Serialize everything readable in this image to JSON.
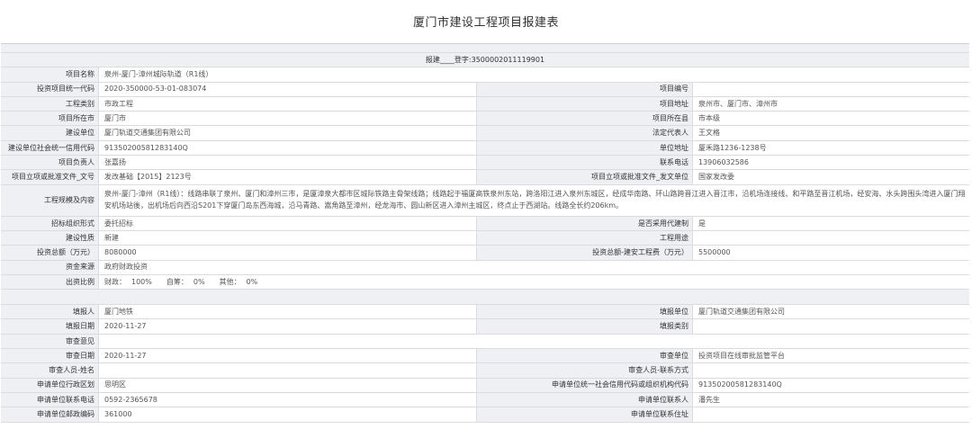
{
  "page_title": "厦门市建设工程项目报建表",
  "header": {
    "reg_label": "报建____登字:",
    "reg_number": "3500002011119901"
  },
  "rows": {
    "project_name": {
      "label": "项目名称",
      "value": "泉州-厦门-漳州城际轨道（R1线）"
    },
    "code": {
      "label": "投资项目统一代码",
      "value": "2020-350000-53-01-083074",
      "label2": "项目编号",
      "value2": ""
    },
    "category": {
      "label": "工程类别",
      "value": "市政工程",
      "label2": "项目地址",
      "value2": "泉州市、厦门市、漳州市"
    },
    "location": {
      "label": "项目所在市",
      "value": "厦门市",
      "label2": "项目所在县",
      "value2": "市本级"
    },
    "builder": {
      "label": "建设单位",
      "value": "厦门轨道交通集团有限公司",
      "label2": "法定代表人",
      "value2": "王文格"
    },
    "credit": {
      "label": "建设单位社会统一信用代码",
      "value": "91350200581283140Q",
      "label2": "单位地址",
      "value2": "厦禾路1236-1238号"
    },
    "leader": {
      "label": "项目负责人",
      "value": "张嘉扬",
      "label2": "联系电话",
      "value2": "13906032586"
    },
    "approval": {
      "label": "项目立项或批准文件_文号",
      "value": "发改基础【2015】2123号",
      "label2": "项目立项或批准文件_发文单位",
      "value2": "国家发改委"
    },
    "scale": {
      "label": "工程规模及内容",
      "value": "泉州-厦门-漳州（R1线）：线路串联了泉州、厦门和漳州三市，是厦漳泉大都市区城际铁路主骨架线路；线路起于福厦高铁泉州东站，跨洛阳江进入泉州东城区，经成华南路、环山路跨晋江进入晋江市，沿机场连接线、和平路至晋江机场，经安海、水头跨围头湾进入厦门翔安机场站後，出机场后向西沿S201下穿厦门岛东西海城，沿马青路、嵩角路至漳州，经龙海市、圆山新区进入漳州主城区，终点止于西湖站。线路全长约206km。"
    },
    "tender": {
      "label": "招标组织形式",
      "value": "委托招标",
      "label2": "是否采用代建制",
      "value2": "是"
    },
    "nature": {
      "label": "建设性质",
      "value": "新建",
      "label2": "工程用途",
      "value2": ""
    },
    "invest": {
      "label": "投资总额（万元）",
      "value": "8080000",
      "label2": "投资总额-建安工程费（万元）",
      "value2": "5500000"
    },
    "funding": {
      "label": "资金来源",
      "value": "政府财政投资"
    },
    "ratio": {
      "label": "出资比例",
      "fin_label": "财政：",
      "fin_value": "100%",
      "self_label": "自筹：",
      "self_value": "0%",
      "other_label": "其他：",
      "other_value": "0%"
    },
    "filler": {
      "label": "填报人",
      "value": "厦门地铁",
      "label2": "填报单位",
      "value2": "厦门轨道交通集团有限公司"
    },
    "fill_date": {
      "label": "填报日期",
      "value": "2020-11-27",
      "label2": "填报类别",
      "value2": ""
    },
    "review_opinion": {
      "label": "审查意见",
      "value": ""
    },
    "review_date": {
      "label": "审查日期",
      "value": "2020-11-27",
      "label2": "审查单位",
      "value2": "投资项目在线审批监管平台"
    },
    "reviewer": {
      "label": "审查人员-姓名",
      "value": "",
      "label2": "审查人员-联系方式",
      "value2": ""
    },
    "applicant_district": {
      "label": "申请单位行政区划",
      "value": "思明区",
      "label2": "申请单位统一社会信用代码或组织机构代码",
      "value2": "91350200581283140Q"
    },
    "applicant_phone": {
      "label": "申请单位联系电话",
      "value": "0592-2365678",
      "label2": "申请单位联系人",
      "value2": "潘先生"
    },
    "applicant_zip": {
      "label": "申请单位邮政编码",
      "value": "361000",
      "label2": "申请单位联系住址",
      "value2": ""
    }
  }
}
